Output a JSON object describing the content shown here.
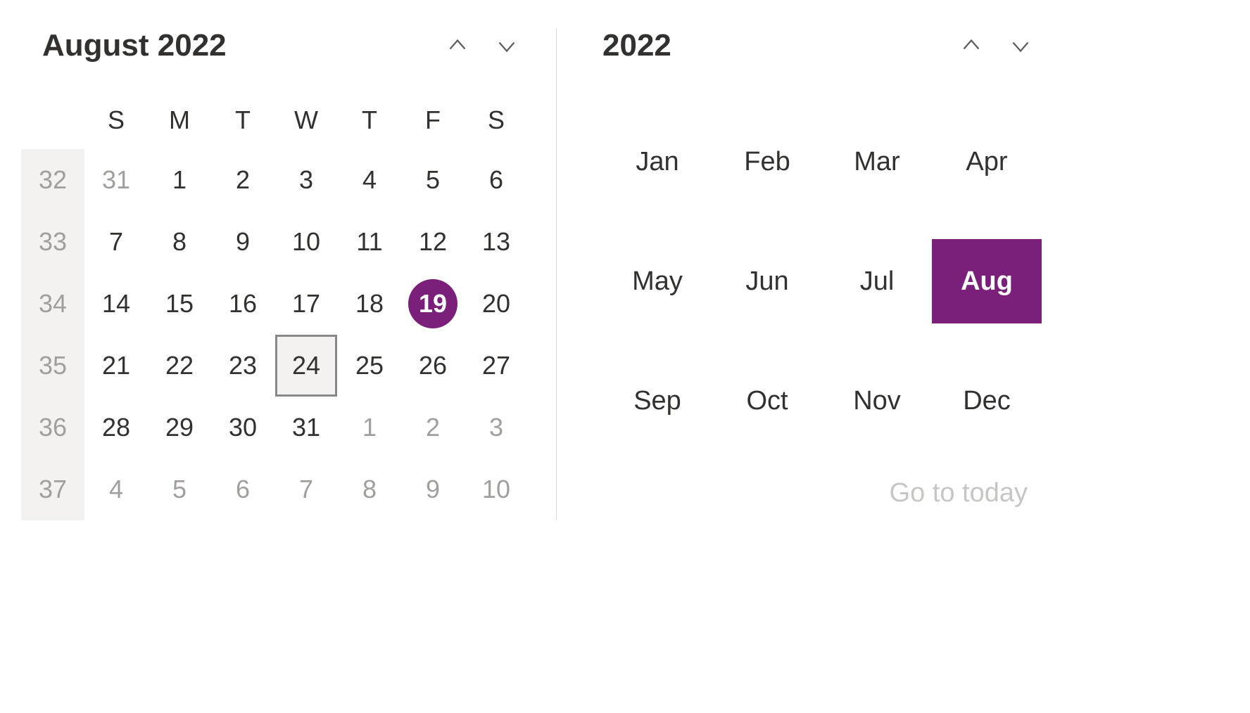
{
  "monthView": {
    "title": "August 2022",
    "weekdays": [
      "S",
      "M",
      "T",
      "W",
      "T",
      "F",
      "S"
    ],
    "weeks": [
      {
        "num": "32",
        "days": [
          {
            "d": "31",
            "outside": true
          },
          {
            "d": "1"
          },
          {
            "d": "2"
          },
          {
            "d": "3"
          },
          {
            "d": "4"
          },
          {
            "d": "5"
          },
          {
            "d": "6"
          }
        ]
      },
      {
        "num": "33",
        "days": [
          {
            "d": "7"
          },
          {
            "d": "8"
          },
          {
            "d": "9"
          },
          {
            "d": "10"
          },
          {
            "d": "11"
          },
          {
            "d": "12"
          },
          {
            "d": "13"
          }
        ]
      },
      {
        "num": "34",
        "days": [
          {
            "d": "14"
          },
          {
            "d": "15"
          },
          {
            "d": "16"
          },
          {
            "d": "17"
          },
          {
            "d": "18"
          },
          {
            "d": "19",
            "selected": true
          },
          {
            "d": "20"
          }
        ]
      },
      {
        "num": "35",
        "days": [
          {
            "d": "21"
          },
          {
            "d": "22"
          },
          {
            "d": "23"
          },
          {
            "d": "24",
            "today": true
          },
          {
            "d": "25"
          },
          {
            "d": "26"
          },
          {
            "d": "27"
          }
        ]
      },
      {
        "num": "36",
        "days": [
          {
            "d": "28"
          },
          {
            "d": "29"
          },
          {
            "d": "30"
          },
          {
            "d": "31"
          },
          {
            "d": "1",
            "outside": true
          },
          {
            "d": "2",
            "outside": true
          },
          {
            "d": "3",
            "outside": true
          }
        ]
      },
      {
        "num": "37",
        "days": [
          {
            "d": "4",
            "outside": true
          },
          {
            "d": "5",
            "outside": true
          },
          {
            "d": "6",
            "outside": true
          },
          {
            "d": "7",
            "outside": true
          },
          {
            "d": "8",
            "outside": true
          },
          {
            "d": "9",
            "outside": true
          },
          {
            "d": "10",
            "outside": true
          }
        ]
      }
    ]
  },
  "yearView": {
    "title": "2022",
    "months": [
      {
        "label": "Jan"
      },
      {
        "label": "Feb"
      },
      {
        "label": "Mar"
      },
      {
        "label": "Apr"
      },
      {
        "label": "May"
      },
      {
        "label": "Jun"
      },
      {
        "label": "Jul"
      },
      {
        "label": "Aug",
        "highlighted": true
      },
      {
        "label": "Sep"
      },
      {
        "label": "Oct"
      },
      {
        "label": "Nov"
      },
      {
        "label": "Dec"
      }
    ],
    "goToday": "Go to today"
  }
}
